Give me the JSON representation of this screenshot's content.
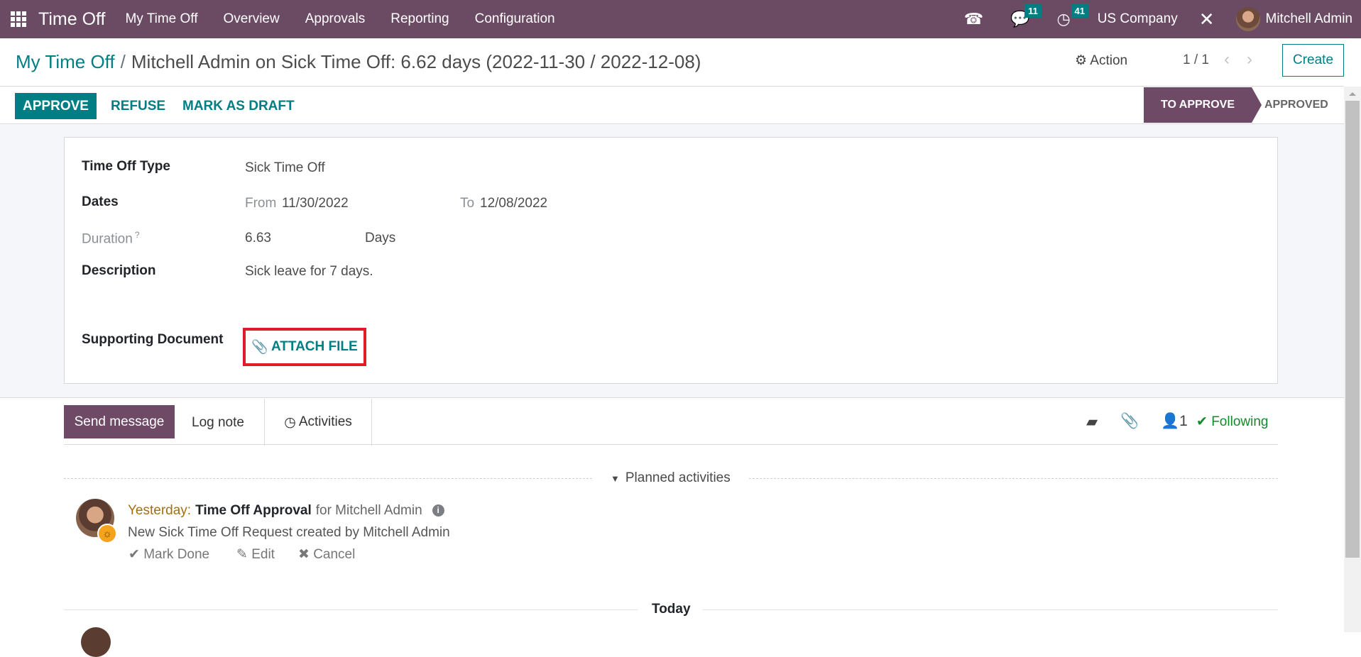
{
  "navbar": {
    "app_name": "Time Off",
    "menu": [
      "My Time Off",
      "Overview",
      "Approvals",
      "Reporting",
      "Configuration"
    ],
    "messages_count": "11",
    "activities_count": "41",
    "company": "US Company",
    "user": "Mitchell Admin",
    "icons": [
      "apps-grid-icon",
      "phone-icon",
      "chat-icon",
      "clock-icon",
      "tools-icon",
      "avatar"
    ]
  },
  "breadcrumb": {
    "parent": "My Time Off",
    "separator": "/",
    "current": "Mitchell Admin on Sick Time Off: 6.62 days (2022-11-30 / 2022-12-08)"
  },
  "control": {
    "action_label": "Action",
    "pager": "1 / 1",
    "create_label": "Create"
  },
  "buttons": {
    "approve": "APPROVE",
    "refuse": "REFUSE",
    "mark_draft": "MARK AS DRAFT"
  },
  "status": {
    "current": "TO APPROVE",
    "next": "APPROVED"
  },
  "form": {
    "type_label": "Time Off Type",
    "type_value": "Sick Time Off",
    "dates_label": "Dates",
    "from_label": "From",
    "from_value": "11/30/2022",
    "to_label": "To",
    "to_value": "12/08/2022",
    "duration_label": "Duration",
    "duration_help": "?",
    "duration_value": "6.63",
    "duration_unit": "Days",
    "description_label": "Description",
    "description_value": "Sick leave for 7 days.",
    "doc_label": "Supporting Document",
    "attach_label": "ATTACH FILE"
  },
  "chatter": {
    "send_message": "Send message",
    "log_note": "Log note",
    "activities": "Activities",
    "followers_count": "1",
    "following": "Following",
    "planned_label": "Planned activities",
    "today_label": "Today",
    "activity": {
      "when": "Yesterday:",
      "title": "Time Off Approval",
      "for": "for Mitchell Admin",
      "note": "New Sick Time Off Request created by Mitchell Admin",
      "mark_done": "Mark Done",
      "edit": "Edit",
      "cancel": "Cancel"
    }
  },
  "colors": {
    "brand": "#6b4a63",
    "accent": "#017e84",
    "highlight_box": "#e21b2b",
    "following": "#128a2c"
  }
}
